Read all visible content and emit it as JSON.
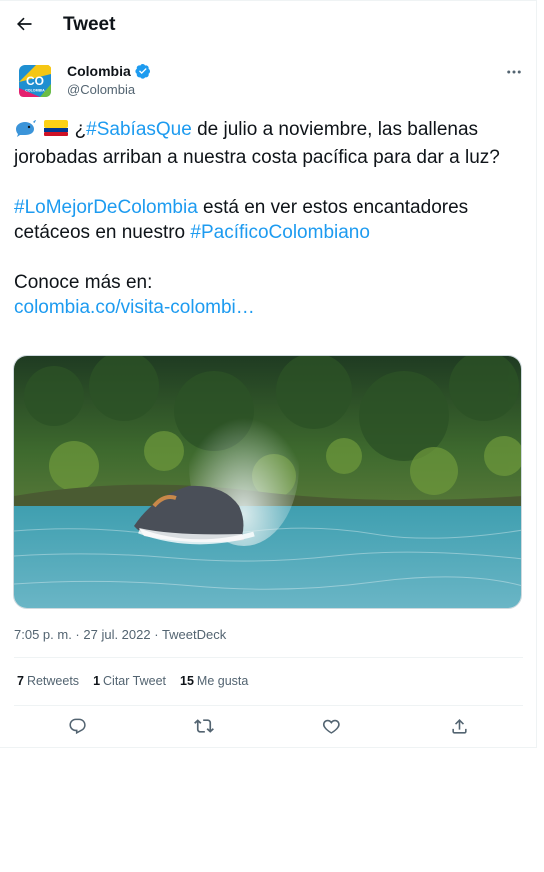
{
  "header": {
    "title": "Tweet"
  },
  "author": {
    "name": "Colombia",
    "handle": "@Colombia",
    "logo_text": "CO",
    "logo_subtext": "COLOMBIA"
  },
  "tweet": {
    "line1_pre": "¿",
    "tag1": "#SabíasQue",
    "line1_post": " de julio a noviembre, las ballenas jorobadas arriban a nuestra costa pacífica para dar a luz?",
    "tag2": "#LoMejorDeColombia",
    "line2_mid": " está en ver estos encantadores cetáceos en nuestro ",
    "tag3": "#PacíficoColombiano",
    "line3": "Conoce más en:",
    "link": "colombia.co/visita-colombi…"
  },
  "meta": {
    "time": "7:05 p. m.",
    "sep": " · ",
    "date": "27 jul. 2022",
    "source": "TweetDeck"
  },
  "stats": {
    "retweets_count": "7",
    "retweets_label": "Retweets",
    "quotes_count": "1",
    "quotes_label": "Citar Tweet",
    "likes_count": "15",
    "likes_label": "Me gusta"
  },
  "icons": {
    "back": "arrow-left-icon",
    "verified": "verified-badge-icon",
    "more": "more-icon",
    "reply": "reply-icon",
    "retweet": "retweet-icon",
    "like": "like-icon",
    "share": "share-icon"
  },
  "colors": {
    "accent": "#1d9bf0",
    "text": "#0f1419",
    "muted": "#536471",
    "border": "#eff3f4"
  }
}
